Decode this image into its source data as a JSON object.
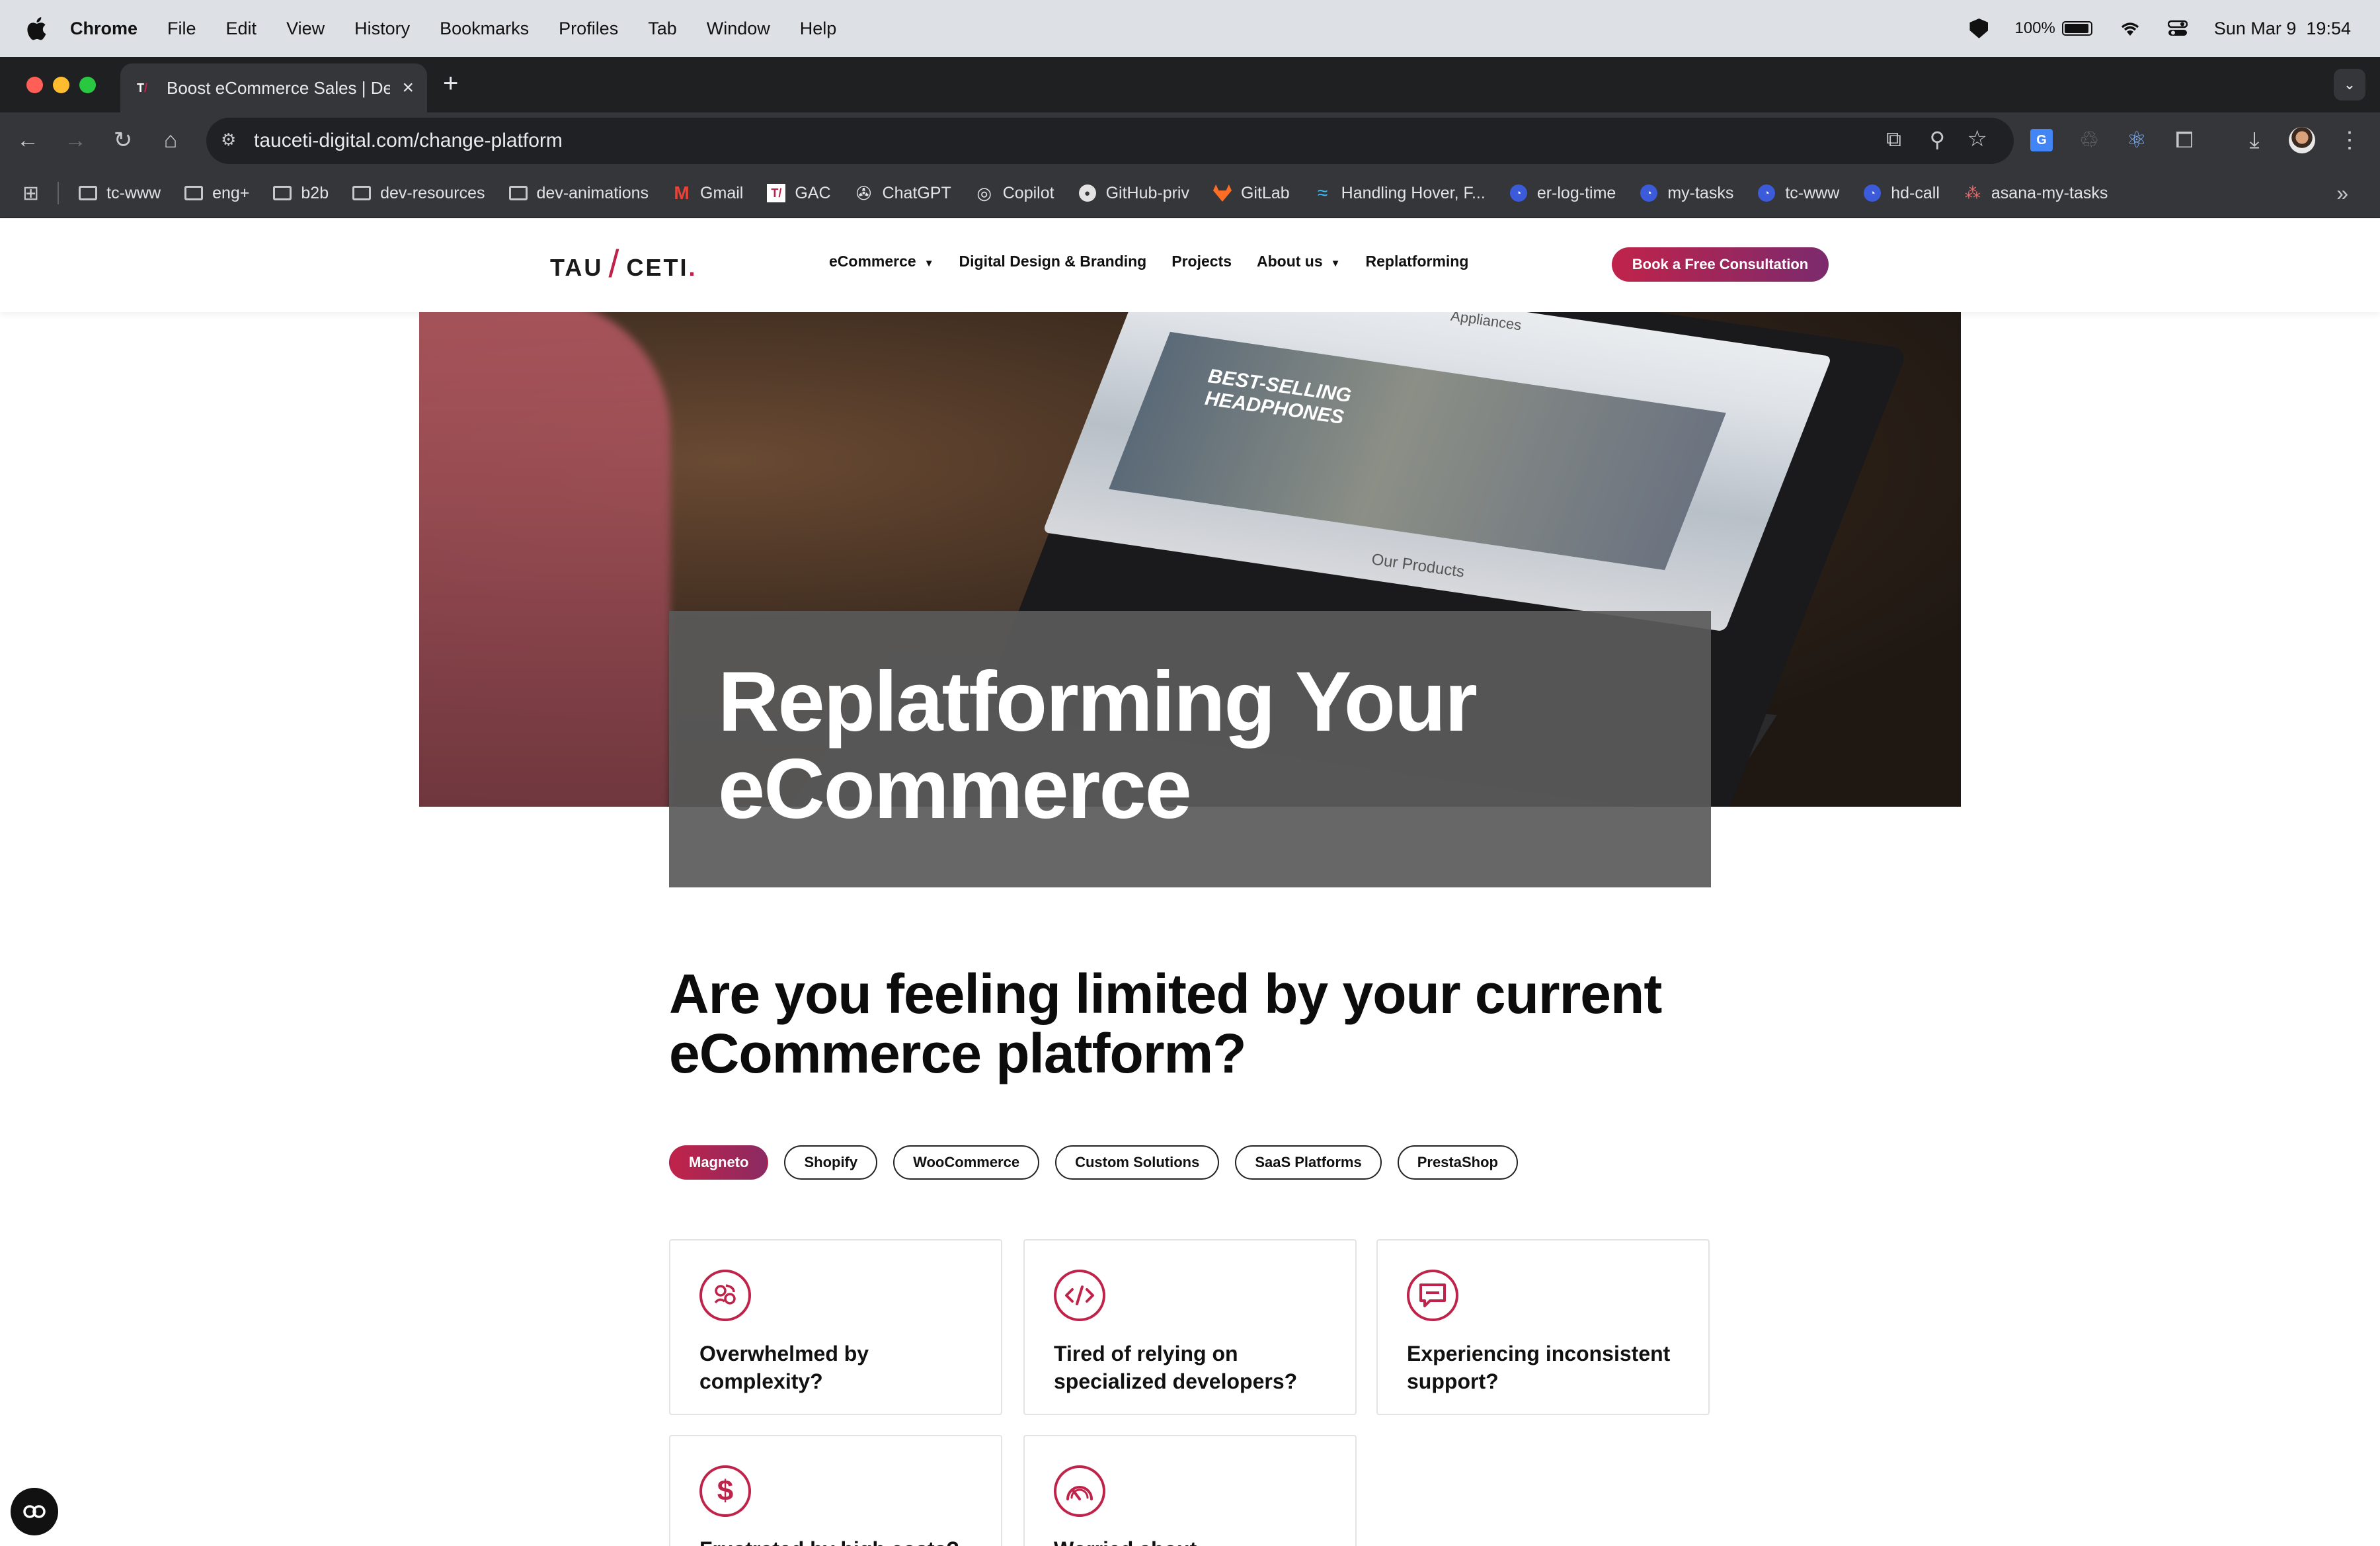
{
  "menubar": {
    "app": "Chrome",
    "items": [
      "File",
      "Edit",
      "View",
      "History",
      "Bookmarks",
      "Profiles",
      "Tab",
      "Window",
      "Help"
    ],
    "battery": "100%",
    "datetime": "Sun Mar 9  19:54"
  },
  "tab": {
    "title": "Boost eCommerce Sales | De",
    "favicon": "T"
  },
  "omnibox": {
    "url": "tauceti-digital.com/change-platform"
  },
  "bookmarks": [
    {
      "label": "tc-www",
      "icon": "folder-icon"
    },
    {
      "label": "eng+",
      "icon": "folder-icon"
    },
    {
      "label": "b2b",
      "icon": "folder-icon"
    },
    {
      "label": "dev-resources",
      "icon": "folder-icon"
    },
    {
      "label": "dev-animations",
      "icon": "folder-icon"
    },
    {
      "label": "Gmail",
      "icon": "gmail-icon"
    },
    {
      "label": "GAC",
      "icon": "gac-icon"
    },
    {
      "label": "ChatGPT",
      "icon": "chatgpt-icon"
    },
    {
      "label": "Copilot",
      "icon": "copilot-icon"
    },
    {
      "label": "GitHub-priv",
      "icon": "github-icon"
    },
    {
      "label": "GitLab",
      "icon": "gitlab-icon"
    },
    {
      "label": "Handling Hover, F...",
      "icon": "tailwind-icon"
    },
    {
      "label": "er-log-time",
      "icon": "clock-icon"
    },
    {
      "label": "my-tasks",
      "icon": "clock-icon"
    },
    {
      "label": "tc-www",
      "icon": "clock-icon"
    },
    {
      "label": "hd-call",
      "icon": "clock-icon"
    },
    {
      "label": "asana-my-tasks",
      "icon": "asana-icon"
    }
  ],
  "site": {
    "logo_left": "TAU",
    "logo_right": "CETI",
    "logo_dot": ".",
    "nav": {
      "ecommerce": "eCommerce",
      "design": "Digital Design & Branding",
      "projects": "Projects",
      "about": "About us",
      "replatforming": "Replatforming"
    },
    "cta": "Book a Free Consultation",
    "hero_screen_text_1": "BEST-SELLING",
    "hero_screen_text_2": "HEADPHONES",
    "hero_screen_products": "Our Products",
    "hero_screen_appliances": "Appliances",
    "hero_title": "Replatforming Your eCommerce",
    "question": "Are you feeling limited by your current eCommerce platform?",
    "pills": [
      "Magneto",
      "Shopify",
      "WooCommerce",
      "Custom Solutions",
      "SaaS Platforms",
      "PrestaShop"
    ],
    "active_pill": "Magneto",
    "cards": [
      {
        "title": "Overwhelmed by complexity?",
        "icon": "complexity-icon"
      },
      {
        "title": "Tired of relying on specialized developers?",
        "icon": "code-icon"
      },
      {
        "title": "Experiencing inconsistent support?",
        "icon": "chat-icon"
      },
      {
        "title": "Frustrated by high costs?",
        "icon": "dollar-icon"
      },
      {
        "title": "Worried about",
        "icon": "speedometer-icon"
      }
    ]
  },
  "colors": {
    "brand": "#c0234a",
    "brand_end": "#7b2a6d"
  }
}
